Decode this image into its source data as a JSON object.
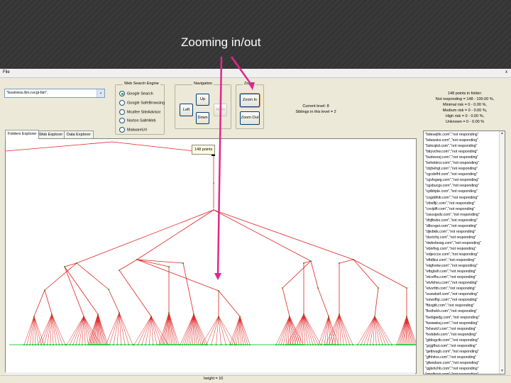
{
  "slide": {
    "title": "Zooming in/out"
  },
  "colors": {
    "annotation_arrow": "#e0288a",
    "tree_edge": "#e02020",
    "tree_node": "#2ecc40"
  },
  "app": {
    "menu": {
      "file": "File",
      "close": "x"
    },
    "search": {
      "value": "\"business.lbn.rucgi-bin\","
    },
    "engine": {
      "title": "Web Search Engine",
      "options": [
        "Google Search",
        "Google SafeBrowsing",
        "Mcafee SiteAdvisor",
        "Norton SafeWeb",
        "MalwareUrl"
      ],
      "selected": "Google Search"
    },
    "navigation": {
      "title": "Navigation",
      "up": "Up",
      "left": "Left",
      "down": "Down",
      "right": "Right"
    },
    "zoom": {
      "title": "Zoom",
      "zoom_in": "Zoom In",
      "zoom_out": "Zoom Out"
    },
    "level": {
      "current": "Current level: 8",
      "siblings": "Siblings in this level = 2"
    },
    "stats": [
      "148 points in folder:",
      "Not responding = 148 - 100.00 %,",
      "Minimal risk = 0 - 0.00 %,",
      "Medium risk = 0 - 0.00 %,",
      "High risk = 0 - 0.00 %,",
      "Unknown = 0 - 0.00 %"
    ],
    "tabs": [
      "Folders Explorer",
      "Web Explorer",
      "Data Explorer"
    ],
    "tooltip": "148 points",
    "status": "height = 10",
    "results": [
      "\"bdeuejhk.com\",\"not responding\"",
      "\"bduiuvks.com\",\"not responding\"",
      "\"bskcqkd.com\",\"not responding\"",
      "\"bttyvchw.com\",\"not responding\"",
      "\"budxexej.com\",\"not responding\"",
      "\"bxhebkcv.com\",\"not responding\"",
      "\"cbjhehgt.com\",\"not responding\"",
      "\"cgcdxfhf.com\",\"not responding\"",
      "\"cgvfsgwg.com\",\"not responding\"",
      "\"cgxbucgv.com\",\"not responding\"",
      "\"cjdbhjde.com\",\"not responding\"",
      "\"csgddhib.com\",\"not responding\"",
      "\"ctbsffjc.com\",\"not responding\"",
      "\"cvvijdft.com\",\"not responding\"",
      "\"cwuvgxdv.com\",\"not responding\"",
      "\"dhjfbxbx.com\",\"not responding\"",
      "\"dlbcvgei.com\",\"not responding\"",
      "\"djivbkik.com\",\"not responding\"",
      "\"ductcfvj.com\",\"not responding\"",
      "\"dwbvbewg.com\",\"not responding\"",
      "\"ebivfivg.com\",\"not responding\"",
      "\"edjeccce.com\",\"not responding\"",
      "\"eftdlkui.com\",\"not responding\"",
      "\"eiigfvxtw.com\",\"not responding\"",
      "\"etbglsih.com\",\"not responding\"",
      "\"etcvifhu.com\",\"not responding\"",
      "\"etvfeheu.com\",\"not responding\"",
      "\"etvvrfdt.com\",\"not responding\"",
      "\"euxwkstf.com\",\"not responding\"",
      "\"exwxfhjc.com\",\"not responding\"",
      "\"fbisgtlt.com\",\"not responding\"",
      "\"fksthvkh.com\",\"not responding\"",
      "\"fsebgwdg.com\",\"not responding\"",
      "\"fsewwksj.com\",\"not responding\"",
      "\"fxhsutcf.com\",\"not responding\"",
      "\"fxvbdelv.com\",\"not responding\"",
      "\"gbbvgctb.com\",\"not responding\"",
      "\"gcjgfhut.com\",\"not responding\"",
      "\"getbvugb.com\",\"not responding\"",
      "\"gfhhitvs.com\",\"not responding\"",
      "\"gfwsdsex.com\",\"not responding\"",
      "\"ggtshchb.com\",\"not responding\"",
      "\"gnelbuwj.com\",\"not responding\""
    ]
  }
}
